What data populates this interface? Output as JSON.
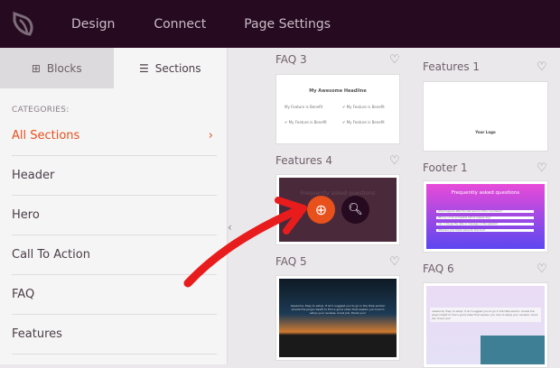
{
  "topbar": {
    "nav": [
      "Design",
      "Connect",
      "Page Settings"
    ]
  },
  "sidebar": {
    "tabs": [
      {
        "label": "Blocks",
        "icon": "blocks-icon"
      },
      {
        "label": "Sections",
        "icon": "sections-icon"
      }
    ],
    "categories_heading": "CATEGORIES:",
    "categories": [
      "All Sections",
      "Header",
      "Hero",
      "Call To Action",
      "FAQ",
      "Features"
    ]
  },
  "gallery": {
    "cards": [
      {
        "label": "FAQ 3",
        "headline": "My Awesome Headline",
        "feature": "My Feature is Benefit"
      },
      {
        "label": "Features 4",
        "headline": "Frequently asked questions"
      },
      {
        "label": "FAQ 5",
        "quote": "Awesome, Easy to setup. If isn't suggest you to go in the Help section (Inside the plugin itself) to find a good video that explain you how to setup your reviews. Good Job, thank you!"
      },
      {
        "label": "Features 1",
        "logo": "Your Logo"
      },
      {
        "label": "Footer 1",
        "headline": "Frequently asked questions",
        "questions": [
          "What happens after the last second of the countdown?",
          "Will my url be accessible before release day?",
          "Can I change the date or message on the website?",
          "What are your future plans for this tool?"
        ]
      },
      {
        "label": "FAQ 6",
        "quote": "Awesome, Easy to setup. If isn't suggest you to go in the Help section (Inside the plugin itself) to find a good video that explain you how to setup your reviews. Good Job, thank you!"
      }
    ]
  },
  "colors": {
    "accent": "#e8501c",
    "topbar": "#260a1f"
  }
}
